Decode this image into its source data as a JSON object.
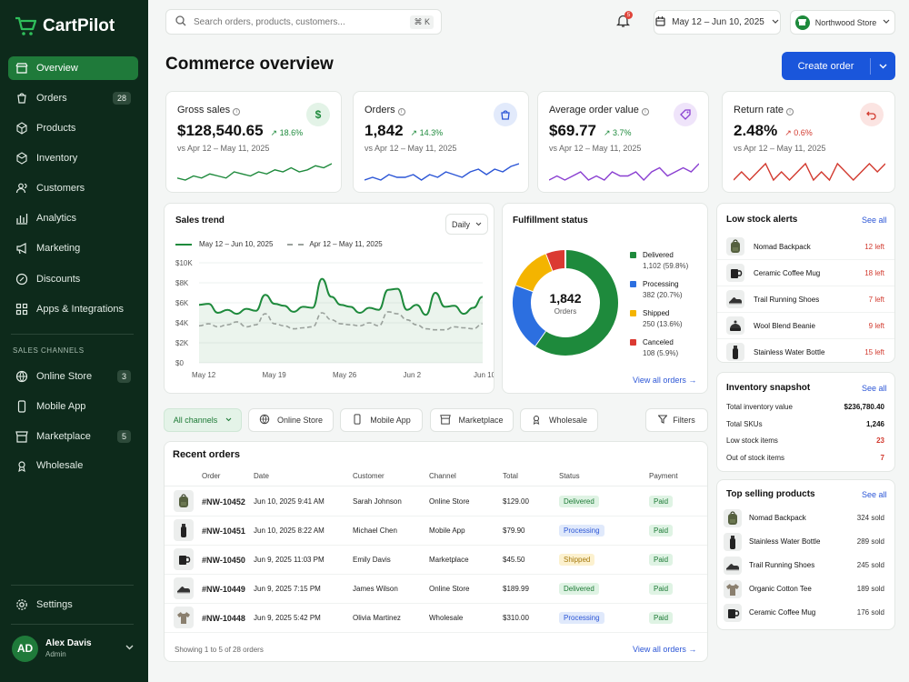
{
  "app": {
    "name": "CartPilot"
  },
  "nav": {
    "items": [
      {
        "label": "Overview",
        "badge": ""
      },
      {
        "label": "Orders",
        "badge": "28"
      },
      {
        "label": "Products",
        "badge": ""
      },
      {
        "label": "Inventory",
        "badge": ""
      },
      {
        "label": "Customers",
        "badge": ""
      },
      {
        "label": "Analytics",
        "badge": ""
      },
      {
        "label": "Marketing",
        "badge": ""
      },
      {
        "label": "Discounts",
        "badge": ""
      },
      {
        "label": "Apps & Integrations",
        "badge": ""
      }
    ],
    "section_label": "SALES CHANNELS",
    "channels": [
      {
        "label": "Online Store",
        "badge": "3"
      },
      {
        "label": "Mobile App",
        "badge": ""
      },
      {
        "label": "Marketplace",
        "badge": "5"
      },
      {
        "label": "Wholesale",
        "badge": ""
      }
    ],
    "settings": "Settings"
  },
  "user": {
    "initials": "AD",
    "name": "Alex Davis",
    "role": "Admin"
  },
  "topbar": {
    "search_placeholder": "Search orders, products, customers...",
    "shortcut": "⌘ K",
    "notif_count": "5",
    "date_range": "May 12 – Jun 10, 2025",
    "store": "Northwood Store"
  },
  "page": {
    "title": "Commerce overview",
    "create_btn": "Create order"
  },
  "kpis": [
    {
      "title": "Gross sales",
      "value": "$128,540.65",
      "change": "↗ 18.6%",
      "trend": "up",
      "compare": "vs Apr 12 – May 11, 2025",
      "icon": "$",
      "color": "#1e8a3c",
      "bg": "#e3f3e7",
      "spark": [
        5,
        4,
        6,
        5,
        7,
        6,
        5,
        8,
        7,
        6,
        8,
        7,
        9,
        8,
        10,
        8,
        9,
        11,
        10,
        12
      ]
    },
    {
      "title": "Orders",
      "value": "1,842",
      "change": "↗ 14.3%",
      "trend": "up",
      "compare": "vs Apr 12 – May 11, 2025",
      "icon": "bag",
      "color": "#2c56d6",
      "bg": "#e2eafb",
      "spark": [
        5,
        6,
        5,
        7,
        6,
        6,
        7,
        5,
        7,
        6,
        8,
        7,
        6,
        8,
        9,
        7,
        9,
        8,
        10,
        11
      ]
    },
    {
      "title": "Average order value",
      "value": "$69.77",
      "change": "↗ 3.7%",
      "trend": "up",
      "compare": "vs Apr 12 – May 11, 2025",
      "icon": "tag",
      "color": "#8a3fd1",
      "bg": "#efe4fa",
      "spark": [
        6,
        7,
        6,
        7,
        8,
        6,
        7,
        6,
        8,
        7,
        7,
        8,
        6,
        8,
        9,
        7,
        8,
        9,
        8,
        10
      ]
    },
    {
      "title": "Return rate",
      "value": "2.48%",
      "change": "↗ 0.6%",
      "trend": "down",
      "compare": "vs Apr 12 – May 11, 2025",
      "icon": "return",
      "color": "#d23a2f",
      "bg": "#fbe4e2",
      "spark": [
        7,
        8,
        7,
        8,
        9,
        7,
        8,
        7,
        8,
        9,
        7,
        8,
        7,
        9,
        8,
        7,
        8,
        9,
        8,
        9
      ]
    }
  ],
  "sales_trend": {
    "title": "Sales trend",
    "period": "Daily",
    "legend_current": "May 12 – Jun 10, 2025",
    "legend_previous": "Apr 12 – May 11, 2025"
  },
  "chart_data": {
    "type": "line",
    "x": [
      "May 12",
      "May 19",
      "May 26",
      "Jun 2",
      "Jun 10"
    ],
    "y_ticks": [
      "$10K",
      "$8K",
      "$6K",
      "$4K",
      "$2K",
      "$0"
    ],
    "ylim": [
      0,
      10000
    ],
    "series": [
      {
        "name": "May 12 – Jun 10, 2025",
        "color": "#1e8a3c",
        "values": [
          5800,
          5900,
          5000,
          5300,
          4900,
          5400,
          5200,
          6800,
          5900,
          5700,
          5100,
          5600,
          5500,
          8400,
          6600,
          5800,
          5600,
          5000,
          5500,
          5300,
          7300,
          7400,
          5300,
          5800,
          4800,
          7000,
          5600,
          5700,
          4900,
          5500,
          6600
        ]
      },
      {
        "name": "Apr 12 – May 11, 2025",
        "color": "#9aa19c",
        "values": [
          3700,
          3900,
          3600,
          3800,
          4100,
          3600,
          3800,
          4900,
          3900,
          3700,
          3400,
          3500,
          3600,
          5000,
          4300,
          3900,
          3800,
          3700,
          4000,
          3700,
          5100,
          4900,
          4300,
          3800,
          3400,
          3300,
          3300,
          3600,
          3500,
          3400,
          3900
        ]
      }
    ]
  },
  "fulfillment": {
    "title": "Fulfillment status",
    "total": "1,842",
    "total_label": "Orders",
    "view_link": "View all orders",
    "segments": [
      {
        "label": "Delivered",
        "value": "1,102 (59.8%)",
        "pct": 59.8,
        "color": "#1e8a3c"
      },
      {
        "label": "Processing",
        "value": "382 (20.7%)",
        "pct": 20.7,
        "color": "#2c6fe0"
      },
      {
        "label": "Shipped",
        "value": "250 (13.6%)",
        "pct": 13.6,
        "color": "#f4b400"
      },
      {
        "label": "Canceled",
        "value": "108 (5.9%)",
        "pct": 5.9,
        "color": "#db3a32"
      }
    ]
  },
  "channel_filters": [
    "All channels",
    "Online Store",
    "Mobile App",
    "Marketplace",
    "Wholesale"
  ],
  "filters_btn": "Filters",
  "orders": {
    "title": "Recent orders",
    "columns": [
      "Order",
      "Date",
      "Customer",
      "Channel",
      "Total",
      "Status",
      "Payment"
    ],
    "rows": [
      {
        "icon": "backpack",
        "id": "#NW-10452",
        "date": "Jun 10, 2025 9:41 AM",
        "customer": "Sarah Johnson",
        "channel": "Online Store",
        "total": "$129.00",
        "status": "Delivered",
        "payment": "Paid"
      },
      {
        "icon": "bottle",
        "id": "#NW-10451",
        "date": "Jun 10, 2025 8:22 AM",
        "customer": "Michael Chen",
        "channel": "Mobile App",
        "total": "$79.90",
        "status": "Processing",
        "payment": "Paid"
      },
      {
        "icon": "mug",
        "id": "#NW-10450",
        "date": "Jun 9, 2025 11:03 PM",
        "customer": "Emily Davis",
        "channel": "Marketplace",
        "total": "$45.50",
        "status": "Shipped",
        "payment": "Paid"
      },
      {
        "icon": "shoe",
        "id": "#NW-10449",
        "date": "Jun 9, 2025 7:15 PM",
        "customer": "James Wilson",
        "channel": "Online Store",
        "total": "$189.99",
        "status": "Delivered",
        "payment": "Paid"
      },
      {
        "icon": "tee",
        "id": "#NW-10448",
        "date": "Jun 9, 2025 5:42 PM",
        "customer": "Olivia Martinez",
        "channel": "Wholesale",
        "total": "$310.00",
        "status": "Processing",
        "payment": "Paid"
      }
    ],
    "footer": "Showing 1 to 5 of 28 orders",
    "view_link": "View all orders"
  },
  "low_stock": {
    "title": "Low stock alerts",
    "see_all": "See all",
    "items": [
      {
        "icon": "backpack",
        "name": "Nomad Backpack",
        "qty": "12 left"
      },
      {
        "icon": "mug",
        "name": "Ceramic Coffee Mug",
        "qty": "18 left"
      },
      {
        "icon": "shoe",
        "name": "Trail Running Shoes",
        "qty": "7 left"
      },
      {
        "icon": "beanie",
        "name": "Wool Blend Beanie",
        "qty": "9 left"
      },
      {
        "icon": "bottle",
        "name": "Stainless Water Bottle",
        "qty": "15 left"
      }
    ]
  },
  "inventory": {
    "title": "Inventory snapshot",
    "see_all": "See all",
    "rows": [
      {
        "label": "Total inventory value",
        "value": "$236,780.40",
        "alert": false
      },
      {
        "label": "Total SKUs",
        "value": "1,246",
        "alert": false
      },
      {
        "label": "Low stock items",
        "value": "23",
        "alert": true
      },
      {
        "label": "Out of stock items",
        "value": "7",
        "alert": true
      }
    ]
  },
  "top_selling": {
    "title": "Top selling products",
    "see_all": "See all",
    "items": [
      {
        "icon": "backpack",
        "name": "Nomad Backpack",
        "sold": "324 sold"
      },
      {
        "icon": "bottle",
        "name": "Stainless Water Bottle",
        "sold": "289 sold"
      },
      {
        "icon": "shoe",
        "name": "Trail Running Shoes",
        "sold": "245 sold"
      },
      {
        "icon": "tee",
        "name": "Organic Cotton Tee",
        "sold": "189 sold"
      },
      {
        "icon": "mug",
        "name": "Ceramic Coffee Mug",
        "sold": "176 sold"
      }
    ]
  }
}
